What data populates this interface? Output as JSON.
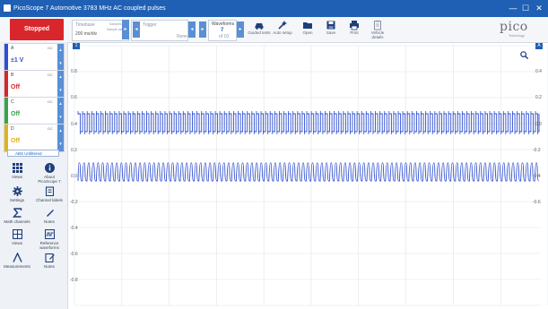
{
  "window": {
    "title": "PicoScope 7 Automotive 3783 MHz AC coupled pulses",
    "minimize": "—",
    "maximize": "☐",
    "close": "✕"
  },
  "toolbar": {
    "run_button": "Stopped",
    "timebase": {
      "label": "Timebase",
      "value": "200 ms/div",
      "sub1": "Samples",
      "sub2": "Sample rate"
    },
    "trigger": {
      "label": "Trigger",
      "value": "None"
    },
    "waveforms": {
      "label": "Waveforms",
      "value": "7",
      "sub": "of 10"
    },
    "tools": [
      {
        "label": "Guided tests",
        "icon": "car-icon"
      },
      {
        "label": "Auto setup",
        "icon": "wand-icon"
      },
      {
        "label": "Open",
        "icon": "folder-icon"
      },
      {
        "label": "Save",
        "icon": "save-icon"
      },
      {
        "label": "Print",
        "icon": "print-icon"
      },
      {
        "label": "Vehicle details",
        "icon": "clipboard-icon"
      }
    ],
    "brand": "pico",
    "brand_sub": "Technology"
  },
  "channels": [
    {
      "name": "A",
      "coupling": "DC",
      "value": "±1 V",
      "color": "#2f4fd1"
    },
    {
      "name": "B",
      "coupling": "DC",
      "value": "Off",
      "color": "#d9262c"
    },
    {
      "name": "C",
      "coupling": "DC",
      "value": "Off",
      "color": "#3aa34a"
    },
    {
      "name": "D",
      "coupling": "DC",
      "value": "Off",
      "color": "#e0b21c"
    }
  ],
  "abs_label": "ABS Unfiltered",
  "side_buttons": [
    {
      "label": "Views",
      "icon": "grid-icon"
    },
    {
      "label": "About PicoScope 7",
      "icon": "info-icon"
    },
    {
      "label": "Settings",
      "icon": "gear-icon"
    },
    {
      "label": "Channel labels",
      "icon": "tag-icon"
    },
    {
      "label": "Math channels",
      "icon": "sigma-icon"
    },
    {
      "label": "Notes",
      "icon": "pen-icon"
    },
    {
      "label": "Views",
      "icon": "window-icon"
    },
    {
      "label": "Reference waveforms",
      "icon": "reference-icon"
    },
    {
      "label": "Measurements",
      "icon": "measure-icon"
    },
    {
      "label": "Notes",
      "icon": "notes-icon"
    }
  ],
  "axis": {
    "left_ticks": [
      "0.8",
      "0.6",
      "0.4",
      "0.2",
      "0.0",
      "-0.2",
      "-0.4",
      "-0.6",
      "-0.8"
    ],
    "right_ticks": [
      "0.4",
      "0.2",
      "0.0",
      "-0.2",
      "-0.4",
      "-0.6"
    ],
    "cursor_left": "1",
    "cursor_right": "A"
  },
  "colors": {
    "trace": "#2f4fd1",
    "accent": "#1f5fb4",
    "stop": "#d9262c",
    "grid": "#dfe4ec"
  }
}
